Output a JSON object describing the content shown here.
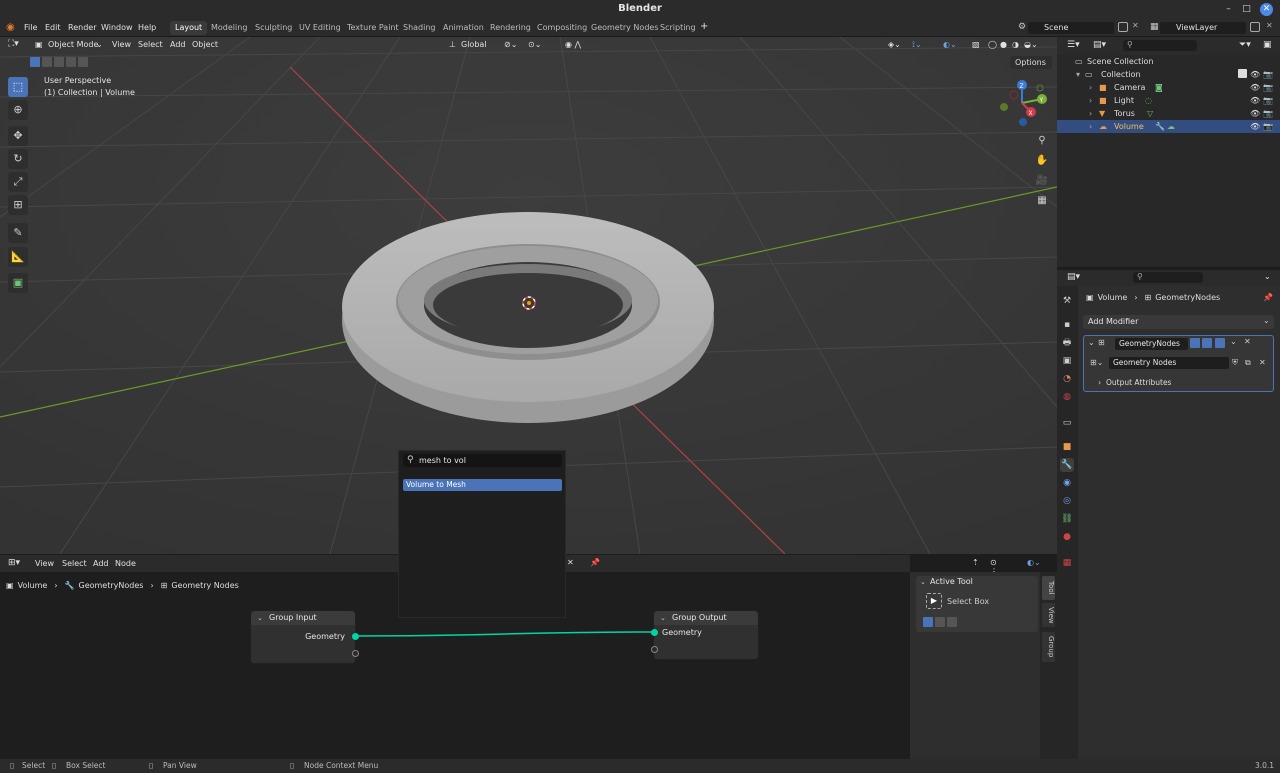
{
  "window": {
    "title": "Blender",
    "minimize_icon": "–",
    "maximize_icon": "□",
    "close_icon": "✕"
  },
  "menu": [
    "File",
    "Edit",
    "Render",
    "Window",
    "Help"
  ],
  "workspaces": [
    "Layout",
    "Modeling",
    "Sculpting",
    "UV Editing",
    "Texture Paint",
    "Shading",
    "Animation",
    "Rendering",
    "Compositing",
    "Geometry Nodes",
    "Scripting"
  ],
  "workspace_add": "+",
  "scene": {
    "scene_name": "Scene",
    "view_layer": "ViewLayer"
  },
  "viewport": {
    "mode": "Object Mode",
    "menus": [
      "View",
      "Select",
      "Add",
      "Object"
    ],
    "orientation": "Global",
    "options_label": "Options",
    "overlay_title": "User Perspective",
    "overlay_subtitle": "(1) Collection | Volume",
    "gizmo_axes": [
      "X",
      "Y",
      "Z"
    ],
    "toolbar_icons": [
      "select-box-icon",
      "cursor-icon",
      "move-icon",
      "rotate-icon",
      "scale-icon",
      "transform-icon",
      "annotate-icon",
      "measure-icon",
      "add-cube-icon"
    ]
  },
  "search_popup": {
    "query": "mesh to vol",
    "result": "Volume to Mesh"
  },
  "node_editor": {
    "menus": [
      "View",
      "Select",
      "Add",
      "Node"
    ],
    "breadcrumb": [
      "Volume",
      "GeometryNodes",
      "Geometry Nodes"
    ],
    "nodes": {
      "group_input": {
        "title": "Group Input",
        "socket": "Geometry"
      },
      "group_output": {
        "title": "Group Output",
        "socket": "Geometry"
      }
    },
    "sidebar": {
      "panel": "Active Tool",
      "tool": "Select Box"
    },
    "tabs": [
      "Tool",
      "View",
      "Group"
    ]
  },
  "outliner": {
    "root": "Scene Collection",
    "collection": "Collection",
    "items": [
      "Camera",
      "Light",
      "Torus",
      "Volume"
    ],
    "selected": "Volume"
  },
  "properties": {
    "breadcrumb_object": "Volume",
    "breadcrumb_modifier": "GeometryNodes",
    "add_modifier": "Add Modifier",
    "modifier_name": "GeometryNodes",
    "node_group": "Geometry Nodes",
    "output_attributes": "Output Attributes"
  },
  "statusbar": {
    "select": "Select",
    "box_select": "Box Select",
    "pan_view": "Pan View",
    "context_menu": "Node Context Menu",
    "version": "3.0.1"
  },
  "colors": {
    "accent": "#4a73b8",
    "geometry_socket": "#00d6a3",
    "x_axis": "#c8404a",
    "y_axis": "#6a9a2a"
  }
}
